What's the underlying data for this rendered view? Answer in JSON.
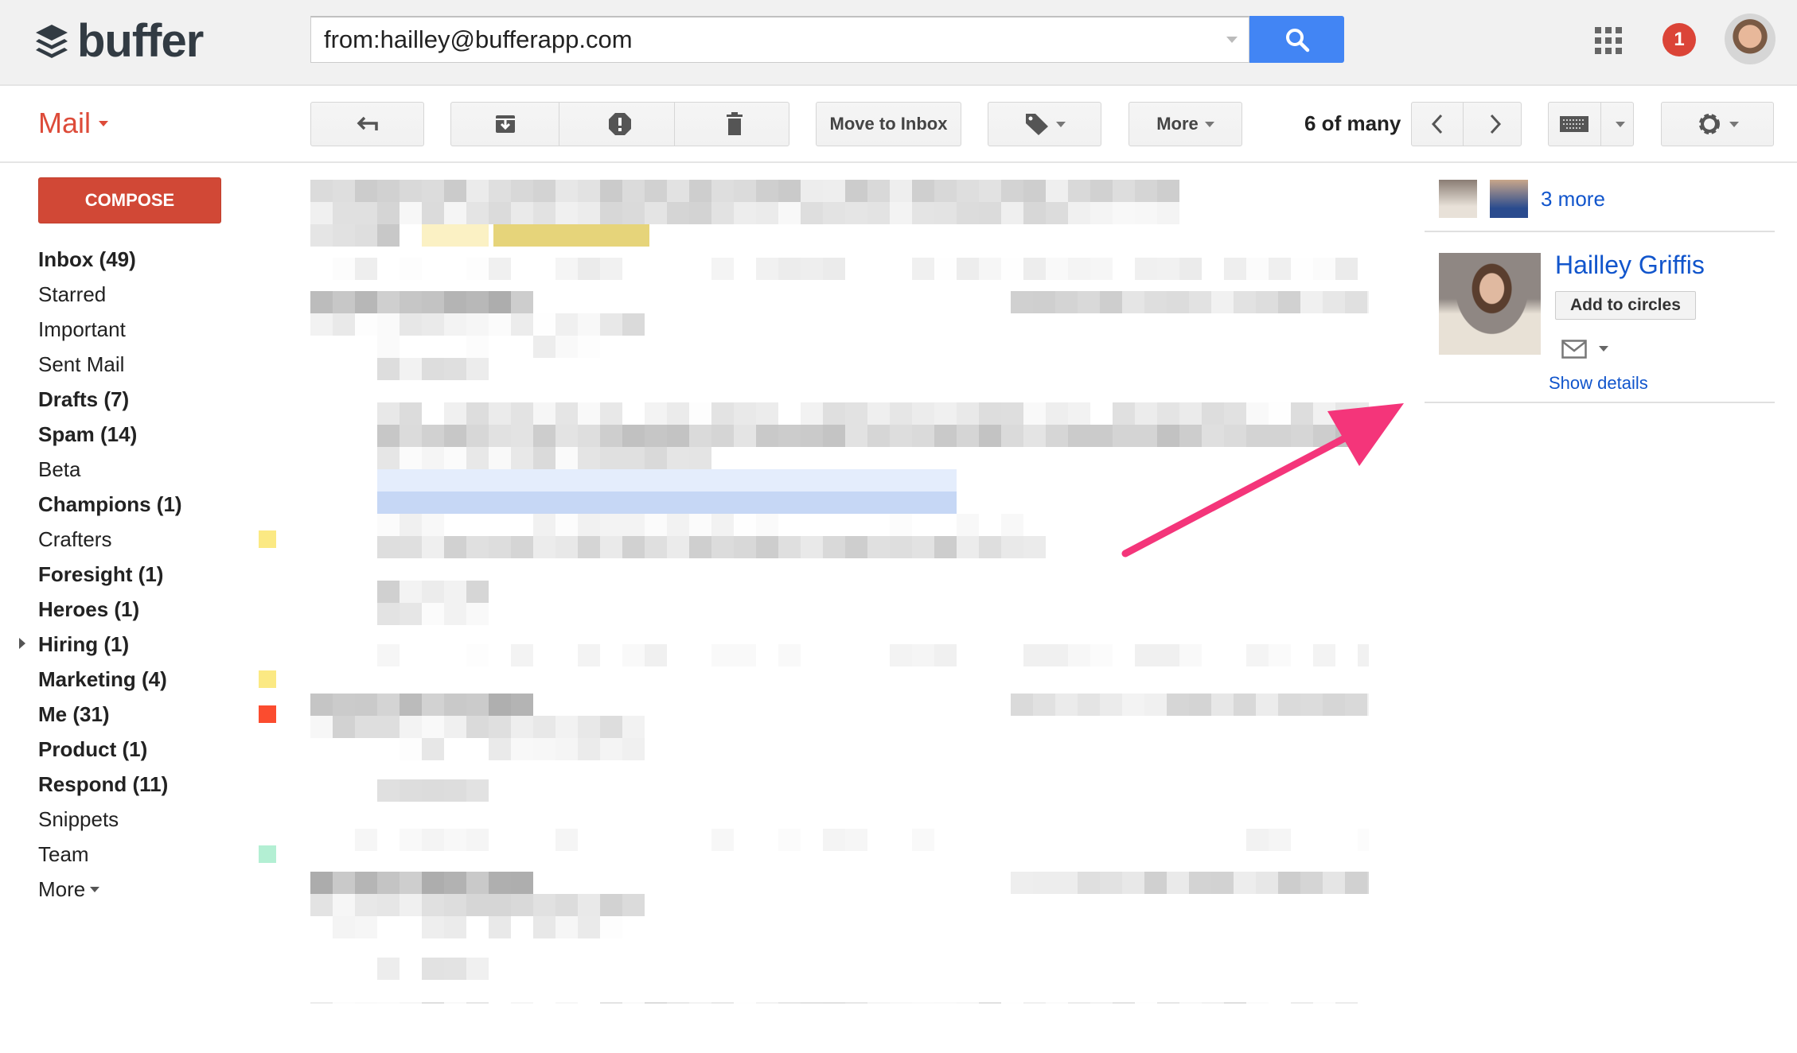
{
  "header": {
    "logo_text": "buffer",
    "search_value": "from:hailley@bufferapp.com",
    "notification_count": "1"
  },
  "toolbar": {
    "app_label": "Mail",
    "move_to_inbox": "Move to Inbox",
    "more": "More",
    "count": "6 of many"
  },
  "sidebar": {
    "compose": "COMPOSE",
    "items": [
      {
        "label": "Inbox (49)",
        "bold": true
      },
      {
        "label": "Starred",
        "bold": false
      },
      {
        "label": "Important",
        "bold": false
      },
      {
        "label": "Sent Mail",
        "bold": false
      },
      {
        "label": "Drafts (7)",
        "bold": true
      },
      {
        "label": "Spam (14)",
        "bold": true
      },
      {
        "label": "Beta",
        "bold": false
      },
      {
        "label": "Champions (1)",
        "bold": true
      },
      {
        "label": "Crafters",
        "bold": false,
        "color": "#fbe983"
      },
      {
        "label": "Foresight (1)",
        "bold": true
      },
      {
        "label": "Heroes (1)",
        "bold": true
      },
      {
        "label": "Hiring (1)",
        "bold": true,
        "expandable": true
      },
      {
        "label": "Marketing (4)",
        "bold": true,
        "color": "#fbe983"
      },
      {
        "label": "Me (31)",
        "bold": true,
        "color": "#fb4c2f"
      },
      {
        "label": "Product (1)",
        "bold": true
      },
      {
        "label": "Respond (11)",
        "bold": true
      },
      {
        "label": "Snippets",
        "bold": false
      },
      {
        "label": "Team",
        "bold": false,
        "color": "#b3efd3"
      }
    ],
    "more": "More"
  },
  "people_panel": {
    "more_people": "3 more",
    "contact_name": "Hailley Griffis",
    "add_to_circles": "Add to circles",
    "show_details": "Show details"
  },
  "colors": {
    "accent": "#dd4b39",
    "search_button": "#4285f4",
    "link": "#1155cc",
    "annotation_arrow": "#f4357a"
  }
}
